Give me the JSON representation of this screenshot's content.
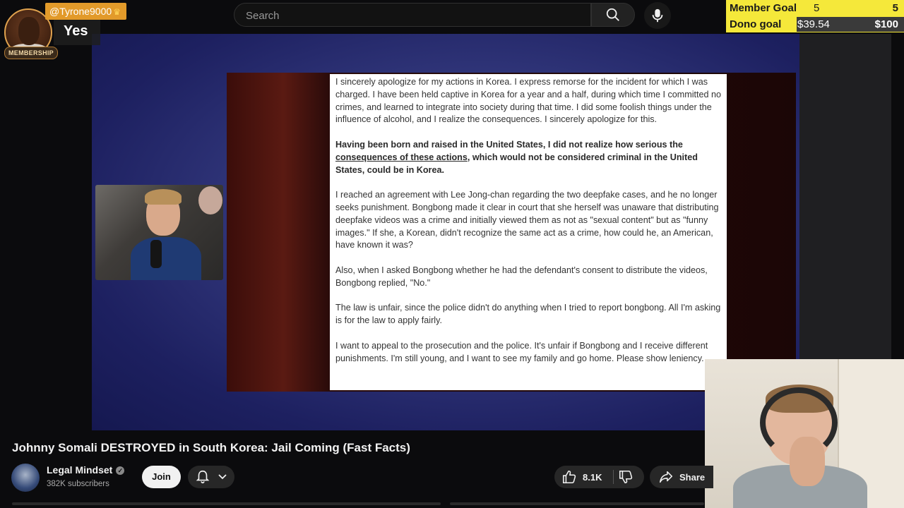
{
  "search": {
    "placeholder": "Search"
  },
  "overlay": {
    "chat_username": "@Tyrone9000",
    "chat_badge": "MEMBERSHIP",
    "chat_message": "Yes",
    "goals": [
      {
        "label": "Member Goal",
        "current": "5",
        "target": "5"
      },
      {
        "label": "Dono goal",
        "current": "$39.54",
        "target": "$100"
      }
    ]
  },
  "document": {
    "p1": "I sincerely apologize for my actions in Korea. I express remorse for the incident for which I was charged. I have been held captive in Korea for a year and a half, during which time I committed no crimes, and learned to integrate into society during that time. I did some foolish things under the influence of alcohol, and I realize the consequences. I sincerely apologize for this.",
    "p2_a": "Having been born and raised in the United States, I did not realize how serious the ",
    "p2_b": "consequences of these actions",
    "p2_c": ", which would not be considered criminal in the United States, could be in Korea.",
    "p3": "I reached an agreement with Lee Jong-chan regarding the two deepfake cases, and he no longer seeks punishment. Bongbong made it clear in court that she herself was unaware that distributing deepfake videos was a crime and initially viewed them as not as \"sexual content\" but as \"funny images.\" If she, a Korean, didn't recognize the same act as a crime, how could he, an American, have known it was?",
    "p4": "Also, when I asked Bongbong whether he had the defendant's consent to distribute the videos, Bongbong replied, \"No.\"",
    "p5": "The law is unfair, since the police didn't do anything when I tried to report bongbong. All I'm asking is for the law to apply fairly.",
    "p6": "I want to appeal to the prosecution and the police. It's unfair if Bongbong and I receive different punishments. I'm still young, and I want to see my family and go home. Please show leniency."
  },
  "video": {
    "title": "Johnny Somali DESTROYED in South Korea: Jail Coming (Fast Facts)",
    "channel_name": "Legal Mindset",
    "subscribers": "382K subscribers",
    "join_label": "Join",
    "like_count": "8.1K",
    "share_label": "Share"
  },
  "colors": {
    "accent_goal": "#f5e83a",
    "chat_name_bg": "#e29a2a"
  }
}
